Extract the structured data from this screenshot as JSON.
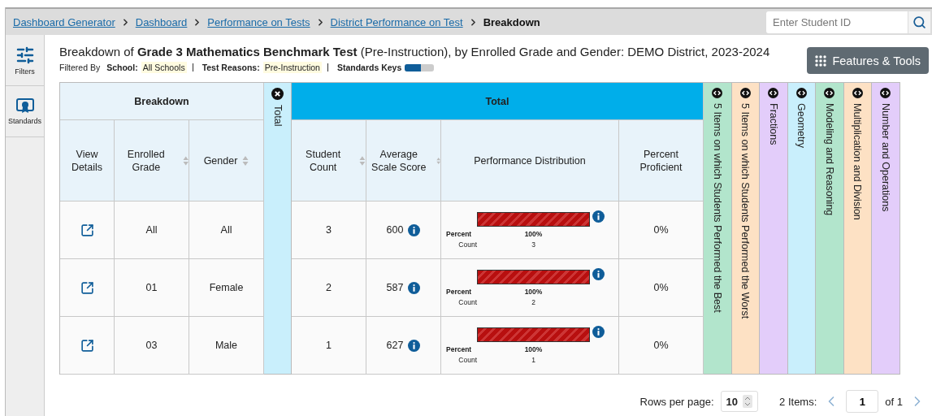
{
  "breadcrumb": [
    {
      "label": "Dashboard Generator",
      "current": false
    },
    {
      "label": "Dashboard",
      "current": false
    },
    {
      "label": "Performance on Tests",
      "current": false
    },
    {
      "label": "District Performance on Test",
      "current": false
    },
    {
      "label": "Breakdown",
      "current": true
    }
  ],
  "search": {
    "placeholder": "Enter Student ID"
  },
  "sidebar": {
    "items": [
      {
        "label": "Filters",
        "kind": "filters"
      },
      {
        "label": "Standards",
        "kind": "standards"
      }
    ]
  },
  "report": {
    "title": "Breakdown of **Grade 3 Mathematics Benchmark Test** (Pre-Instruction), by Enrolled Grade and Gender: DEMO District, 2023-2024",
    "filtered_by": "Filtered By",
    "filters": [
      {
        "label": "School:",
        "value": "All Schools"
      },
      {
        "label": "Test Reasons:",
        "value": "Pre-Instruction"
      }
    ],
    "standards_keys": "Standards Keys",
    "features_button": "Features & Tools"
  },
  "table": {
    "breakdown_header": "Breakdown",
    "total_column": "Total",
    "total_header": "Total",
    "columns": [
      {
        "label": "View Details",
        "sortable": false
      },
      {
        "label": "Enrolled Grade",
        "sortable": true
      },
      {
        "label": "Gender",
        "sortable": true
      },
      {
        "label": "Student Count",
        "sortable": true
      },
      {
        "label": "Average Scale Score",
        "sortable": true
      },
      {
        "label": "Performance Distribution",
        "sortable": false
      },
      {
        "label": "Percent Proficient",
        "sortable": false
      }
    ],
    "rows": [
      {
        "grade": "All",
        "gender": "All",
        "student_count": "3",
        "average_score": "600",
        "level": 1,
        "percent_label": "Percent",
        "percent": "100%",
        "count_label": "Count",
        "count": "3",
        "proficient": "0%"
      },
      {
        "grade": "01",
        "gender": "Female",
        "student_count": "2",
        "average_score": "587",
        "level": 1,
        "percent_label": "Percent",
        "percent": "100%",
        "count_label": "Count",
        "count": "2",
        "proficient": "0%"
      },
      {
        "grade": "03",
        "gender": "Male",
        "student_count": "1",
        "average_score": "627",
        "level": 1,
        "percent_label": "Percent",
        "percent": "100%",
        "count_label": "Count",
        "count": "1",
        "proficient": "0%"
      }
    ],
    "standards": [
      {
        "label": "5 Items on which Students Performed the Best",
        "color": "#b2e5cc"
      },
      {
        "label": "5 Items on which Students Performed the Worst",
        "color": "#fde1c4"
      },
      {
        "label": "Fractions",
        "color": "#e3cdfa"
      },
      {
        "label": "Geometry",
        "color": "#c9effc"
      },
      {
        "label": "Modeling and Reasoning",
        "color": "#b2e5cc"
      },
      {
        "label": "Multiplication and Division",
        "color": "#fde1c4"
      },
      {
        "label": "Number and Operations",
        "color": "#e3cdfa"
      }
    ]
  },
  "pagination": {
    "rows_per_page_label": "Rows per page:",
    "rows_per_page": "10",
    "items": "2 Items:",
    "page": "1",
    "of": "of 1"
  }
}
